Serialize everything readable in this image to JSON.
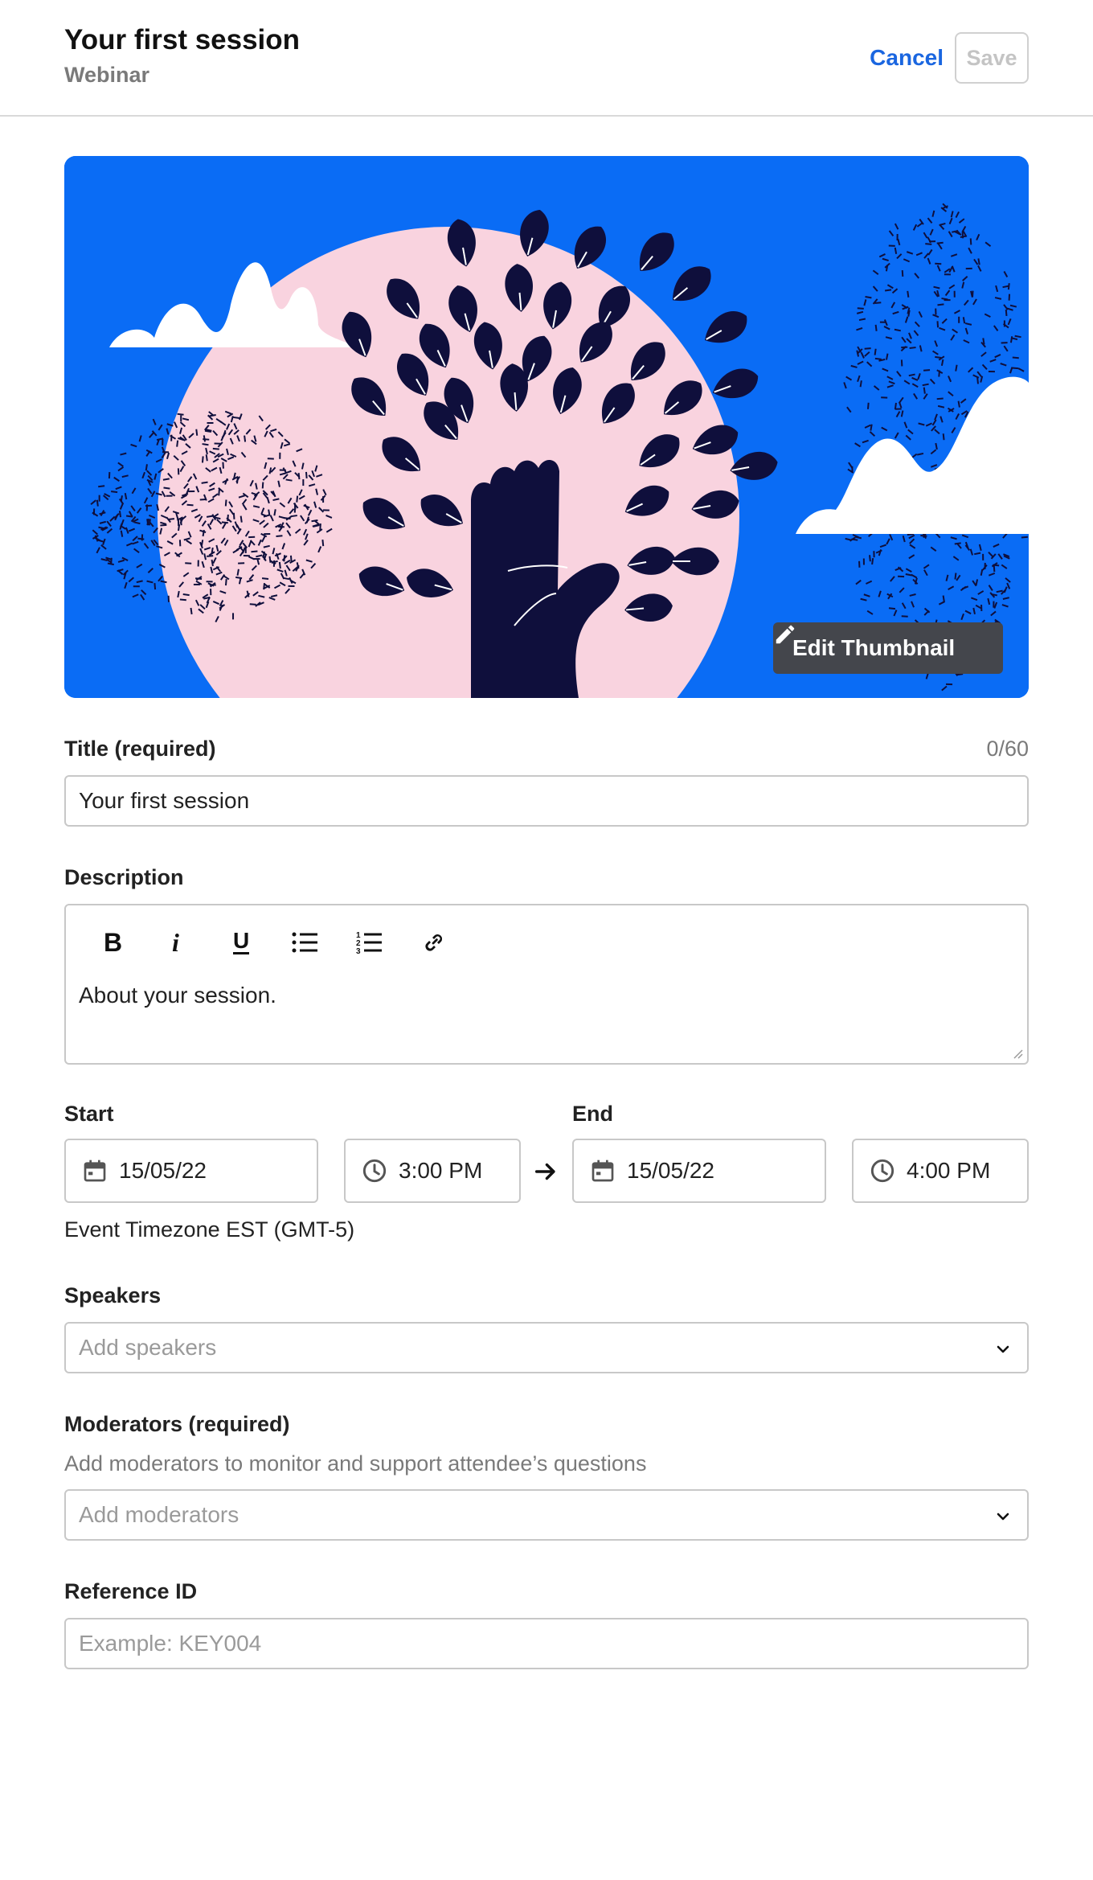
{
  "header": {
    "title": "Your first session",
    "subtitle": "Webinar",
    "cancel_label": "Cancel",
    "save_label": "Save"
  },
  "thumbnail": {
    "edit_label": "Edit Thumbnail",
    "background_color": "#0a6cf5",
    "circle_color": "#f9d3df",
    "tree_color": "#0f0f3c"
  },
  "title_field": {
    "label": "Title (required)",
    "counter": "0/60",
    "value": "Your first session"
  },
  "description": {
    "label": "Description",
    "toolbar": [
      "bold-icon",
      "italic-icon",
      "underline-icon",
      "bullet-list-icon",
      "numbered-list-icon",
      "link-icon"
    ],
    "value": "About your session."
  },
  "schedule": {
    "start_label": "Start",
    "end_label": "End",
    "start_date": "15/05/22",
    "start_time": "3:00 PM",
    "end_date": "15/05/22",
    "end_time": "4:00 PM",
    "timezone": "Event Timezone EST (GMT-5)"
  },
  "speakers": {
    "label": "Speakers",
    "placeholder": "Add speakers"
  },
  "moderators": {
    "label": "Moderators (required)",
    "hint": "Add moderators to monitor and support attendee’s questions",
    "placeholder": "Add moderators"
  },
  "reference": {
    "label": "Reference ID",
    "placeholder": "Example: KEY004"
  },
  "colors": {
    "accent": "#1a66e0",
    "border": "#c8c8c8",
    "muted_text": "#7a7a7a"
  }
}
